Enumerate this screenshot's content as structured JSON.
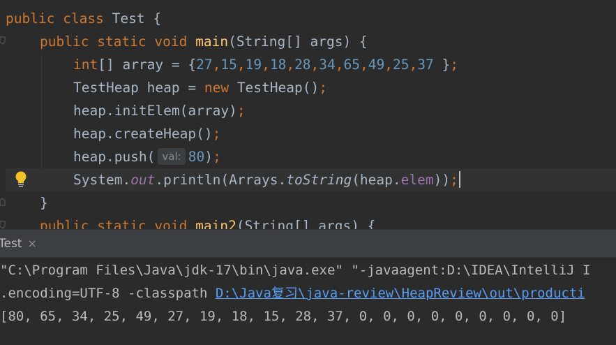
{
  "editor": {
    "line1": {
      "kw1": "public",
      "kw2": "class",
      "name": "Test {"
    },
    "line2": {
      "kw1": "public",
      "kw2": "static",
      "kw3": "void",
      "method": "main",
      "rest": "(String[] args) {"
    },
    "line3": {
      "type": "int",
      "decl": "[] array = {",
      "nums": [
        "27",
        "15",
        "19",
        "18",
        "28",
        "34",
        "65",
        "49",
        "25",
        "37"
      ],
      "end_brace": " }",
      "semi": ";"
    },
    "line4": {
      "pre": "TestHeap heap = ",
      "kw": "new",
      "post": " TestHeap()",
      "semi": ";"
    },
    "line5": {
      "text": "heap.initElem(array)",
      "semi": ";"
    },
    "line6": {
      "text": "heap.createHeap()",
      "semi": ";"
    },
    "line7": {
      "pre": "heap.push(",
      "hint": "val:",
      "num": "80",
      "post": ")",
      "semi": ";"
    },
    "line8": {
      "a": "System.",
      "out": "out",
      "b": ".println(Arrays.",
      "to_string": "toString",
      "c": "(heap.",
      "elem": "elem",
      "d": "))",
      "semi": ";"
    },
    "line9": {
      "text": "}"
    },
    "line10": {
      "kw1": "public",
      "kw2": "static",
      "kw3": "void",
      "method": "main2",
      "rest": "(String[] args) {"
    }
  },
  "run_panel": {
    "tab_label": "Test",
    "tab_close": "×",
    "console": {
      "line1": "\"C:\\Program Files\\Java\\jdk-17\\bin\\java.exe\" \"-javaagent:D:\\IDEA\\IntelliJ I",
      "line2_prefix": ".encoding=UTF-8 -classpath ",
      "line2_link": "D:\\Java复习\\java-review\\HeapReview\\out\\producti",
      "line3": "[80, 65, 34, 25, 49, 27, 19, 18, 15, 28, 37, 0, 0, 0, 0, 0, 0, 0, 0, 0]"
    }
  },
  "colors": {
    "background": "#2b2b2b",
    "keyword": "#cc7832",
    "method": "#ffc66d",
    "number": "#6897bb",
    "field": "#9876aa",
    "text": "#a9b7c6",
    "link": "#589df6"
  },
  "icons": [
    "fold-marker-icon",
    "lightbulb-icon",
    "close-icon"
  ]
}
